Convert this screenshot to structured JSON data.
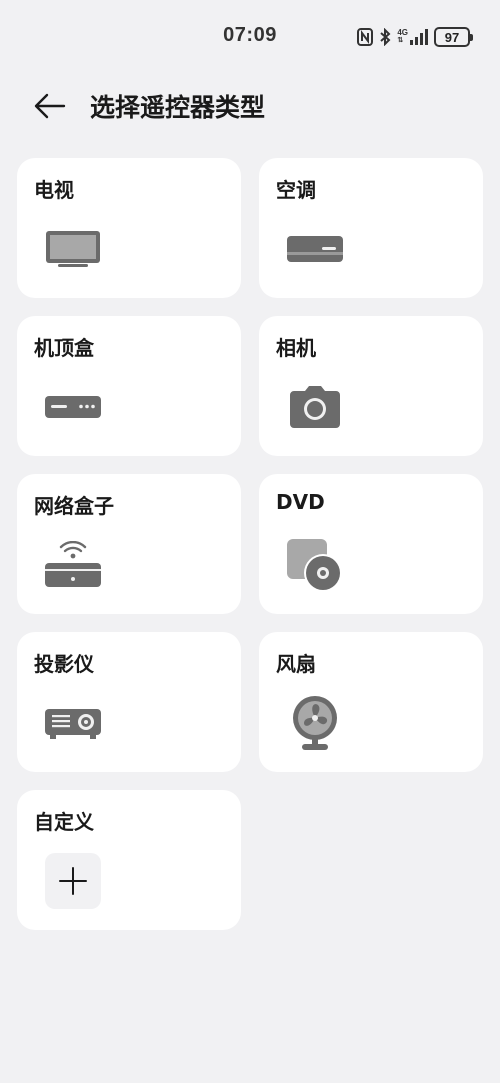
{
  "status": {
    "time": "07:09",
    "network": "4G",
    "battery": "97"
  },
  "header": {
    "title": "选择遥控器类型"
  },
  "devices": [
    {
      "label": "电视",
      "icon": "tv-icon"
    },
    {
      "label": "空调",
      "icon": "air-conditioner-icon"
    },
    {
      "label": "机顶盒",
      "icon": "set-top-box-icon"
    },
    {
      "label": "相机",
      "icon": "camera-icon"
    },
    {
      "label": "网络盒子",
      "icon": "network-box-icon"
    },
    {
      "label": "DVD",
      "icon": "dvd-icon"
    },
    {
      "label": "投影仪",
      "icon": "projector-icon"
    },
    {
      "label": "风扇",
      "icon": "fan-icon"
    },
    {
      "label": "自定义",
      "icon": "plus-icon"
    }
  ],
  "colors": {
    "background": "#f1f1f3",
    "card": "#ffffff",
    "icon": "#6b6b6b"
  }
}
